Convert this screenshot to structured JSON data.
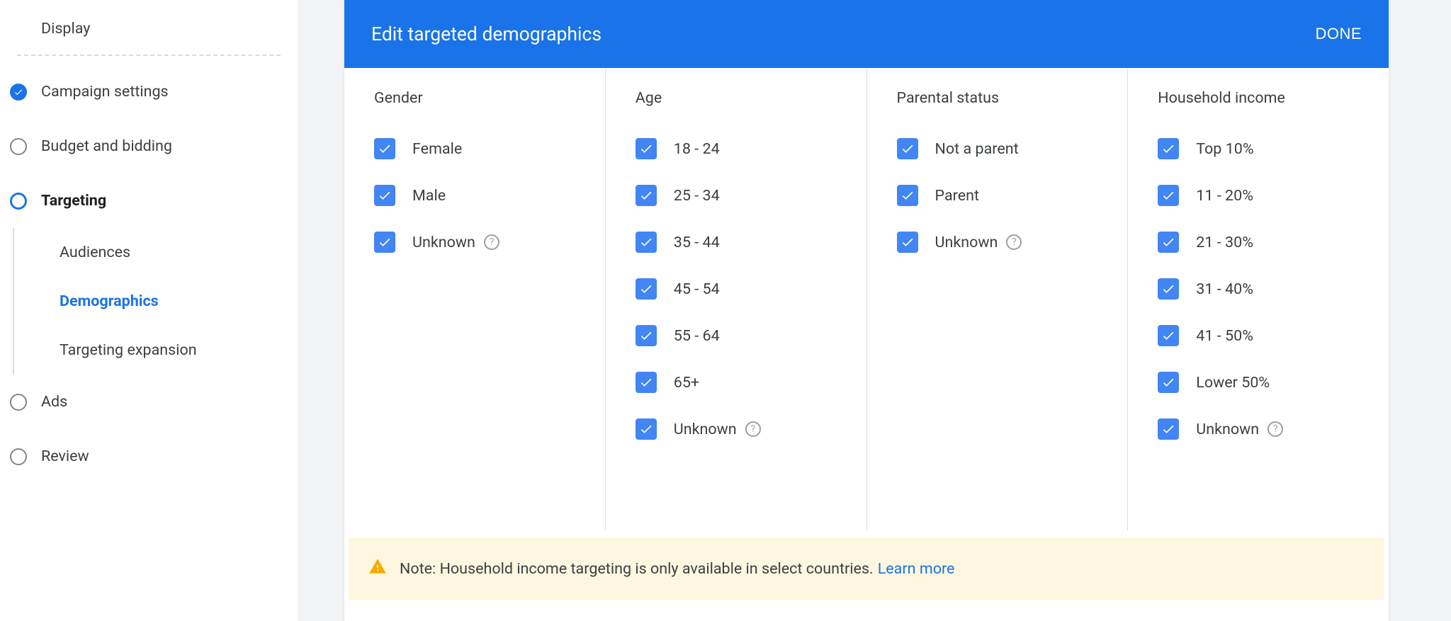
{
  "sidebar": {
    "section": "Display",
    "items": [
      {
        "label": "Campaign settings",
        "state": "done"
      },
      {
        "label": "Budget and bidding",
        "state": "pending"
      },
      {
        "label": "Targeting",
        "state": "current",
        "children": [
          {
            "label": "Audiences",
            "active": false
          },
          {
            "label": "Demographics",
            "active": true
          },
          {
            "label": "Targeting expansion",
            "active": false
          }
        ]
      },
      {
        "label": "Ads",
        "state": "pending"
      },
      {
        "label": "Review",
        "state": "pending"
      }
    ]
  },
  "panel": {
    "title": "Edit targeted demographics",
    "done": "DONE",
    "columns": {
      "gender": {
        "header": "Gender",
        "options": [
          {
            "label": "Female",
            "checked": true
          },
          {
            "label": "Male",
            "checked": true
          },
          {
            "label": "Unknown",
            "checked": true,
            "help": true
          }
        ]
      },
      "age": {
        "header": "Age",
        "options": [
          {
            "label": "18 - 24",
            "checked": true
          },
          {
            "label": "25 - 34",
            "checked": true
          },
          {
            "label": "35 - 44",
            "checked": true
          },
          {
            "label": "45 - 54",
            "checked": true
          },
          {
            "label": "55 - 64",
            "checked": true
          },
          {
            "label": "65+",
            "checked": true
          },
          {
            "label": "Unknown",
            "checked": true,
            "help": true
          }
        ]
      },
      "parental": {
        "header": "Parental status",
        "options": [
          {
            "label": "Not a parent",
            "checked": true
          },
          {
            "label": "Parent",
            "checked": true
          },
          {
            "label": "Unknown",
            "checked": true,
            "help": true
          }
        ]
      },
      "income": {
        "header": "Household income",
        "options": [
          {
            "label": "Top 10%",
            "checked": true
          },
          {
            "label": "11 - 20%",
            "checked": true
          },
          {
            "label": "21 - 30%",
            "checked": true
          },
          {
            "label": "31 - 40%",
            "checked": true
          },
          {
            "label": "41 - 50%",
            "checked": true
          },
          {
            "label": "Lower 50%",
            "checked": true
          },
          {
            "label": "Unknown",
            "checked": true,
            "help": true
          }
        ]
      }
    },
    "note": {
      "text": "Note: Household income targeting is only available in select countries.",
      "link": "Learn more"
    }
  }
}
